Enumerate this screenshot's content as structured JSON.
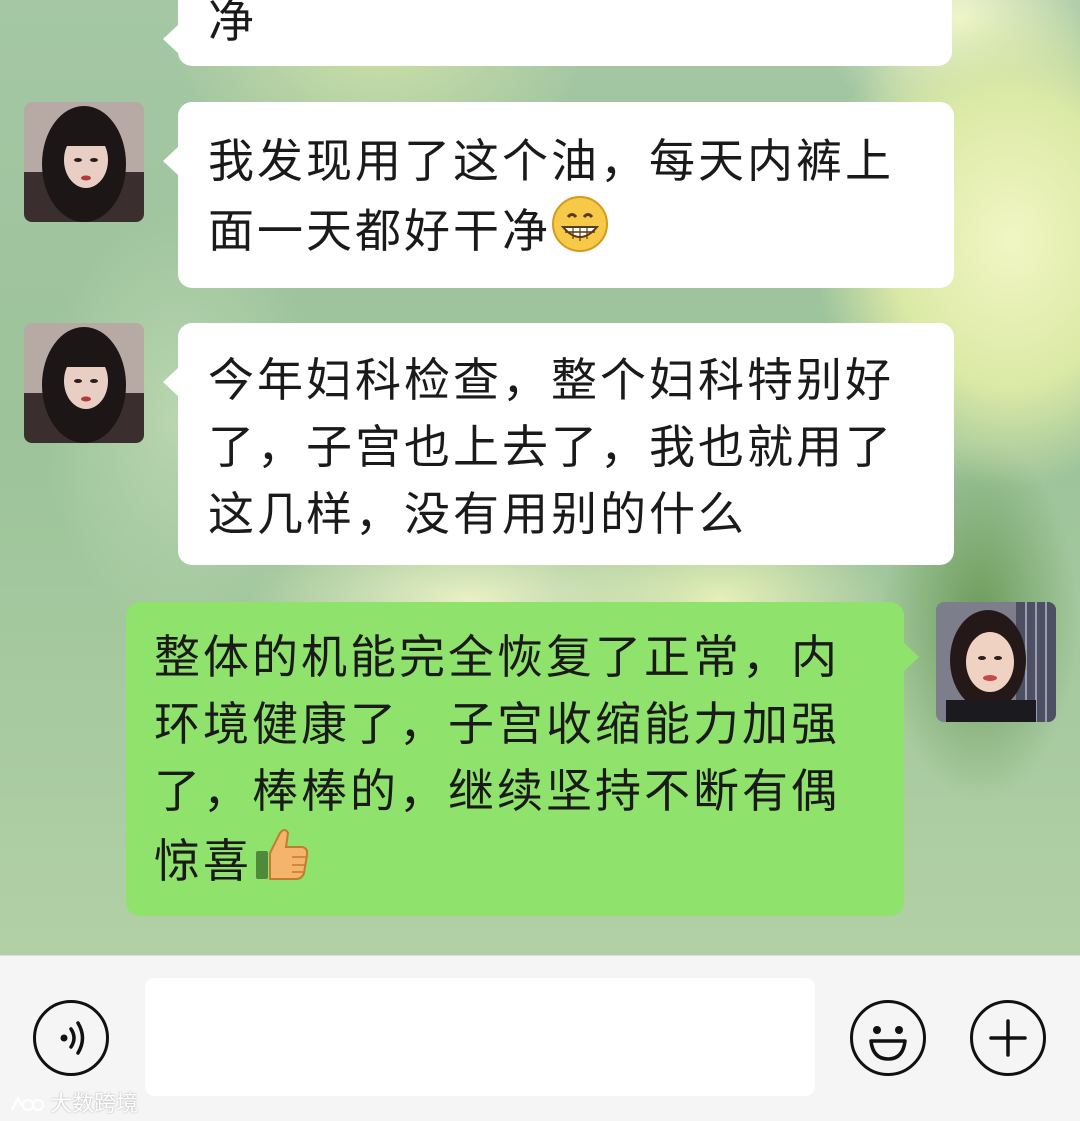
{
  "messages": [
    {
      "side": "left",
      "text_lines": [
        "净"
      ]
    },
    {
      "side": "left",
      "text_lines": [
        "我发现用了这个油，每天内裤上",
        "面一天都好干净"
      ],
      "emoji": "grinning-face-emoji"
    },
    {
      "side": "left",
      "text_lines": [
        "今年妇科检查，整个妇科特别好",
        "了，子宫也上去了，我也就用了",
        "这几样，没有用别的什么"
      ]
    },
    {
      "side": "right",
      "text_lines": [
        "整体的机能完全恢复了正常，内",
        "环境健康了，子宫收缩能力加强",
        "了，棒棒的，继续坚持不断有偶",
        "惊喜"
      ],
      "emoji": "thumbs-up-emoji"
    }
  ],
  "input_bar": {
    "voice_icon": "voice-icon",
    "text_value": "",
    "emoji_icon": "smiley-icon",
    "more_icon": "plus-icon"
  },
  "watermark": {
    "text": "大数跨境"
  },
  "colors": {
    "received_bubble": "#ffffff",
    "sent_bubble": "#8fe26b",
    "input_bar": "#f5f5f5"
  }
}
